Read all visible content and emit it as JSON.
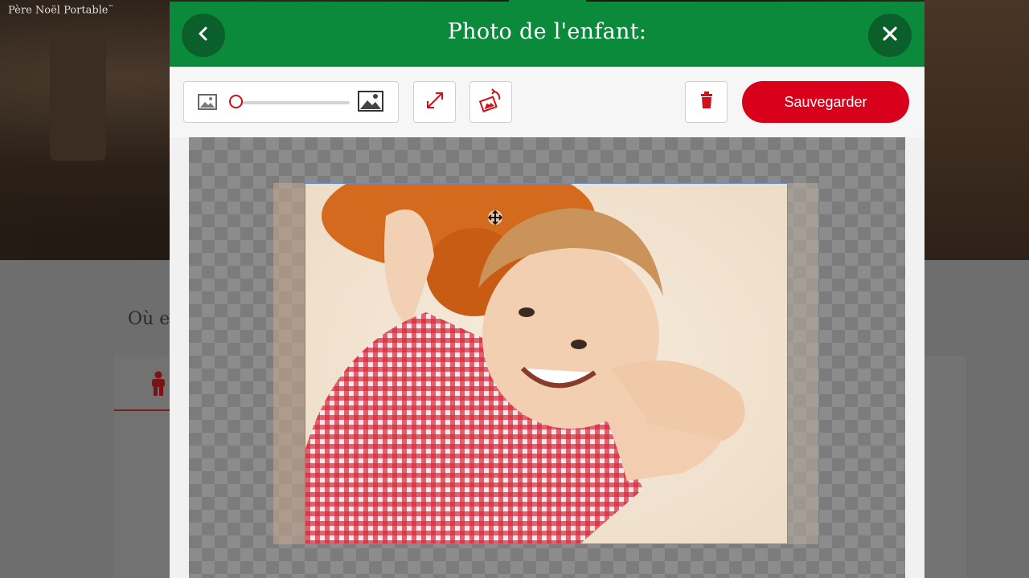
{
  "background": {
    "brand_name": "Père Noël Portable",
    "brand_mark": "™",
    "question_text": "Où e",
    "tab_icon": "child-icon"
  },
  "modal": {
    "title": "Photo de l'enfant:",
    "back_icon": "chevron-left-icon",
    "close_icon": "close-icon",
    "header_color": "#0b8a3c"
  },
  "toolbar": {
    "zoom_out_icon": "image-small-icon",
    "zoom_in_icon": "image-large-icon",
    "zoom_level": 0,
    "fit_icon": "expand-icon",
    "rotate_icon": "rotate-image-icon",
    "delete_icon": "trash-icon",
    "save_label": "Sauvegarder",
    "accent_color": "#d9001b"
  },
  "editor": {
    "move_cursor_icon": "move-icon"
  }
}
